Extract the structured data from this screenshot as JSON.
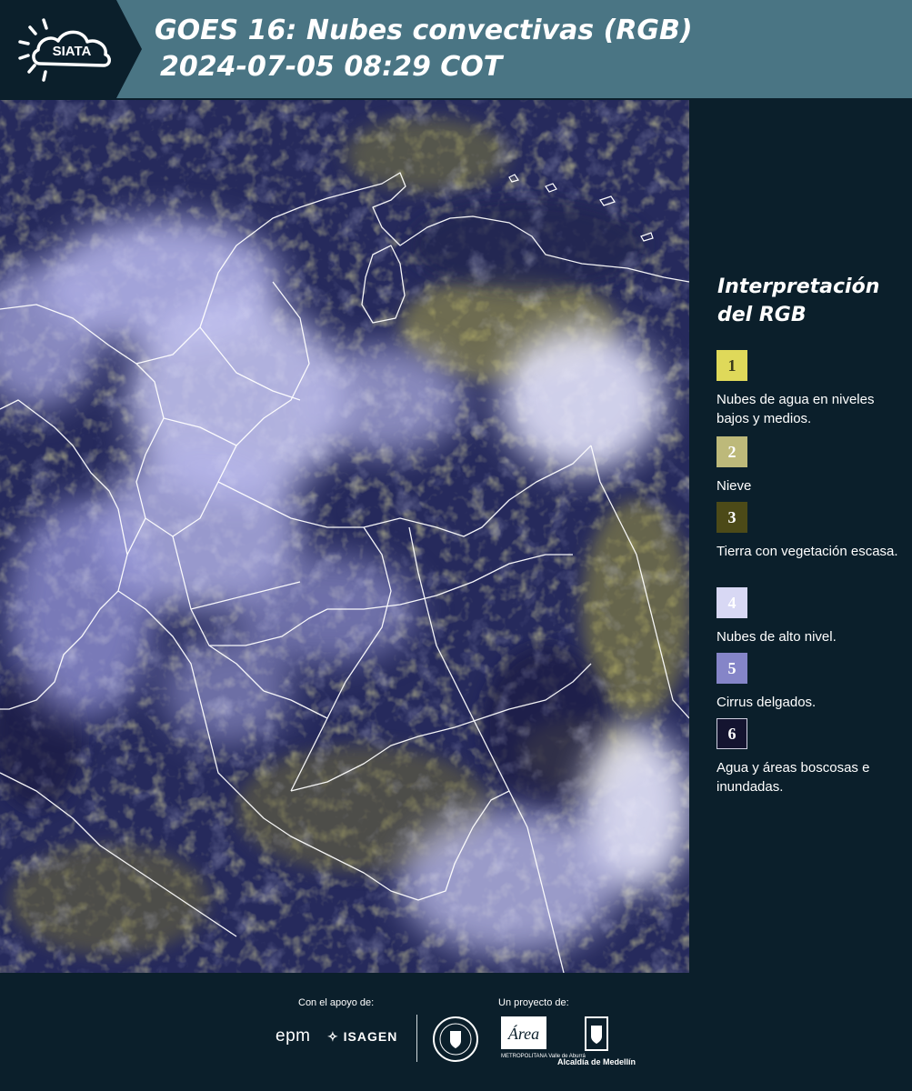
{
  "header": {
    "logo_text": "SIATA",
    "title_line1": "GOES 16: Nubes convectivas (RGB)",
    "title_line2": "2024-07-05 08:29 COT"
  },
  "colors": {
    "header_bg": "#4a7584",
    "panel_bg": "#0b1f2b",
    "boundary_lines": "#ffffff"
  },
  "legend": {
    "title": "Interpretación del RGB",
    "items": [
      {
        "number": "1",
        "color": "#dfd95a",
        "text_color": "#3a3a1a",
        "label": "Nubes de agua en niveles bajos y medios."
      },
      {
        "number": "2",
        "color": "#bdb97a",
        "text_color": "#ffffff",
        "label": "Nieve"
      },
      {
        "number": "3",
        "color": "#4c4a18",
        "text_color": "#ffffff",
        "label": "Tierra con vegetación escasa."
      },
      {
        "number": "4",
        "color": "#d8d8f4",
        "text_color": "#ffffff",
        "label": "Nubes de alto nivel."
      },
      {
        "number": "5",
        "color": "#8585c8",
        "text_color": "#ffffff",
        "label": "Cirrus delgados."
      },
      {
        "number": "6",
        "color": "#141430",
        "text_color": "#ffffff",
        "label": "Agua y áreas boscosas e inundadas."
      }
    ]
  },
  "footer": {
    "support_label": "Con el apoyo de:",
    "project_label": "Un proyecto de:",
    "sponsor_epm": "epm",
    "sponsor_isagen": "ISAGEN",
    "partner_area": "Área",
    "partner_area_sub": "METROPOLITANA Valle de Aburrá",
    "partner_medellin": "Alcaldía de Medellín"
  }
}
